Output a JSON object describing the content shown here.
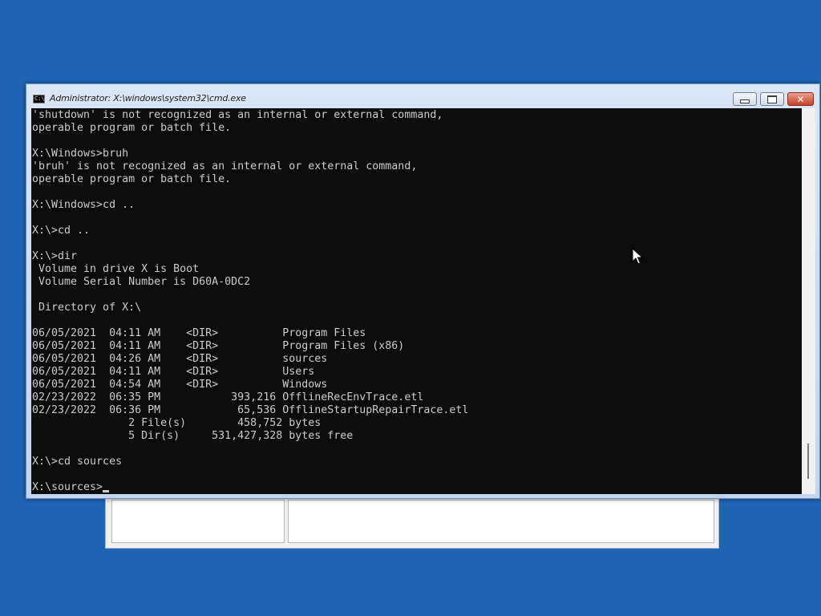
{
  "window": {
    "title": "Administrator: X:\\windows\\system32\\cmd.exe",
    "icon_label": "C:\\",
    "buttons": {
      "minimize": "minimize-icon",
      "maximize": "maximize-icon",
      "close": "close-icon"
    }
  },
  "console": {
    "lines": [
      "'shutdown' is not recognized as an internal or external command,",
      "operable program or batch file.",
      "",
      "X:\\Windows>bruh",
      "'bruh' is not recognized as an internal or external command,",
      "operable program or batch file.",
      "",
      "X:\\Windows>cd ..",
      "",
      "X:\\>cd ..",
      "",
      "X:\\>dir",
      " Volume in drive X is Boot",
      " Volume Serial Number is D60A-0DC2",
      "",
      " Directory of X:\\",
      "",
      "06/05/2021  04:11 AM    <DIR>          Program Files",
      "06/05/2021  04:11 AM    <DIR>          Program Files (x86)",
      "06/05/2021  04:26 AM    <DIR>          sources",
      "06/05/2021  04:11 AM    <DIR>          Users",
      "06/05/2021  04:54 AM    <DIR>          Windows",
      "02/23/2022  06:35 PM           393,216 OfflineRecEnvTrace.etl",
      "02/23/2022  06:36 PM            65,536 OfflineStartupRepairTrace.etl",
      "               2 File(s)        458,752 bytes",
      "               5 Dir(s)     531,427,328 bytes free",
      "",
      "X:\\>cd sources",
      "",
      "X:\\sources>"
    ]
  },
  "colors": {
    "desktop": "#1f63b3",
    "console_bg": "#0c0c0c",
    "console_fg": "#cccccc"
  }
}
